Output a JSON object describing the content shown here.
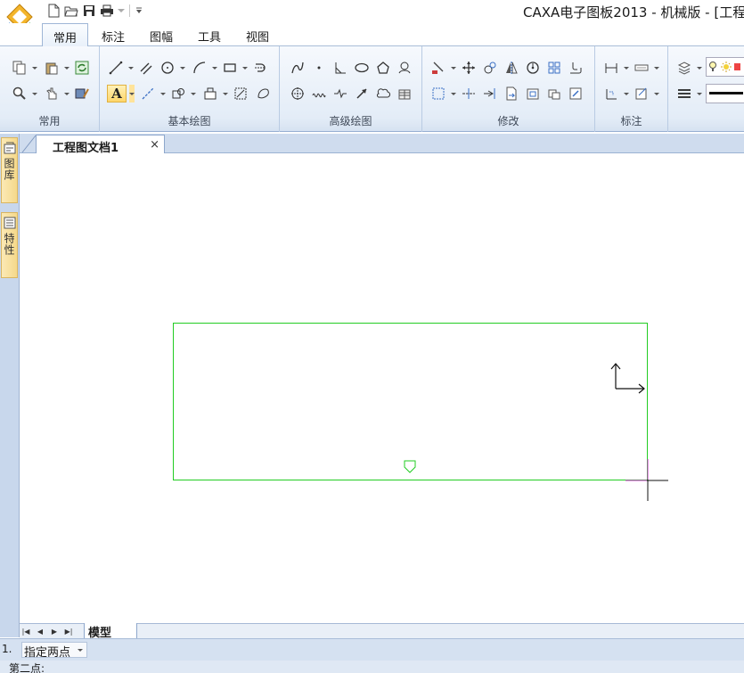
{
  "window": {
    "title": "CAXA电子图板2013 - 机械版 - [工程"
  },
  "ribbon": {
    "tabs": [
      {
        "label": "常用",
        "active": true
      },
      {
        "label": "标注",
        "active": false
      },
      {
        "label": "图幅",
        "active": false
      },
      {
        "label": "工具",
        "active": false
      },
      {
        "label": "视图",
        "active": false
      }
    ],
    "groups": {
      "common": "常用",
      "basic_draw": "基本绘图",
      "advanced_draw": "高级绘图",
      "modify": "修改",
      "dimension": "标注"
    },
    "text_tool_glyph": "A"
  },
  "document": {
    "tab_label": "工程图文档1",
    "close_glyph": "×"
  },
  "side_panels": {
    "library_label": "图库",
    "properties_label": "特性"
  },
  "sheets": {
    "model_tab": "模型"
  },
  "command": {
    "index": "1.",
    "mode": "指定两点",
    "prompt": "第二点:"
  },
  "colors": {
    "drawing_line": "#22cc22",
    "ribbon_bg": "#e3ecf7",
    "selection_cursor": "#cc33cc"
  }
}
